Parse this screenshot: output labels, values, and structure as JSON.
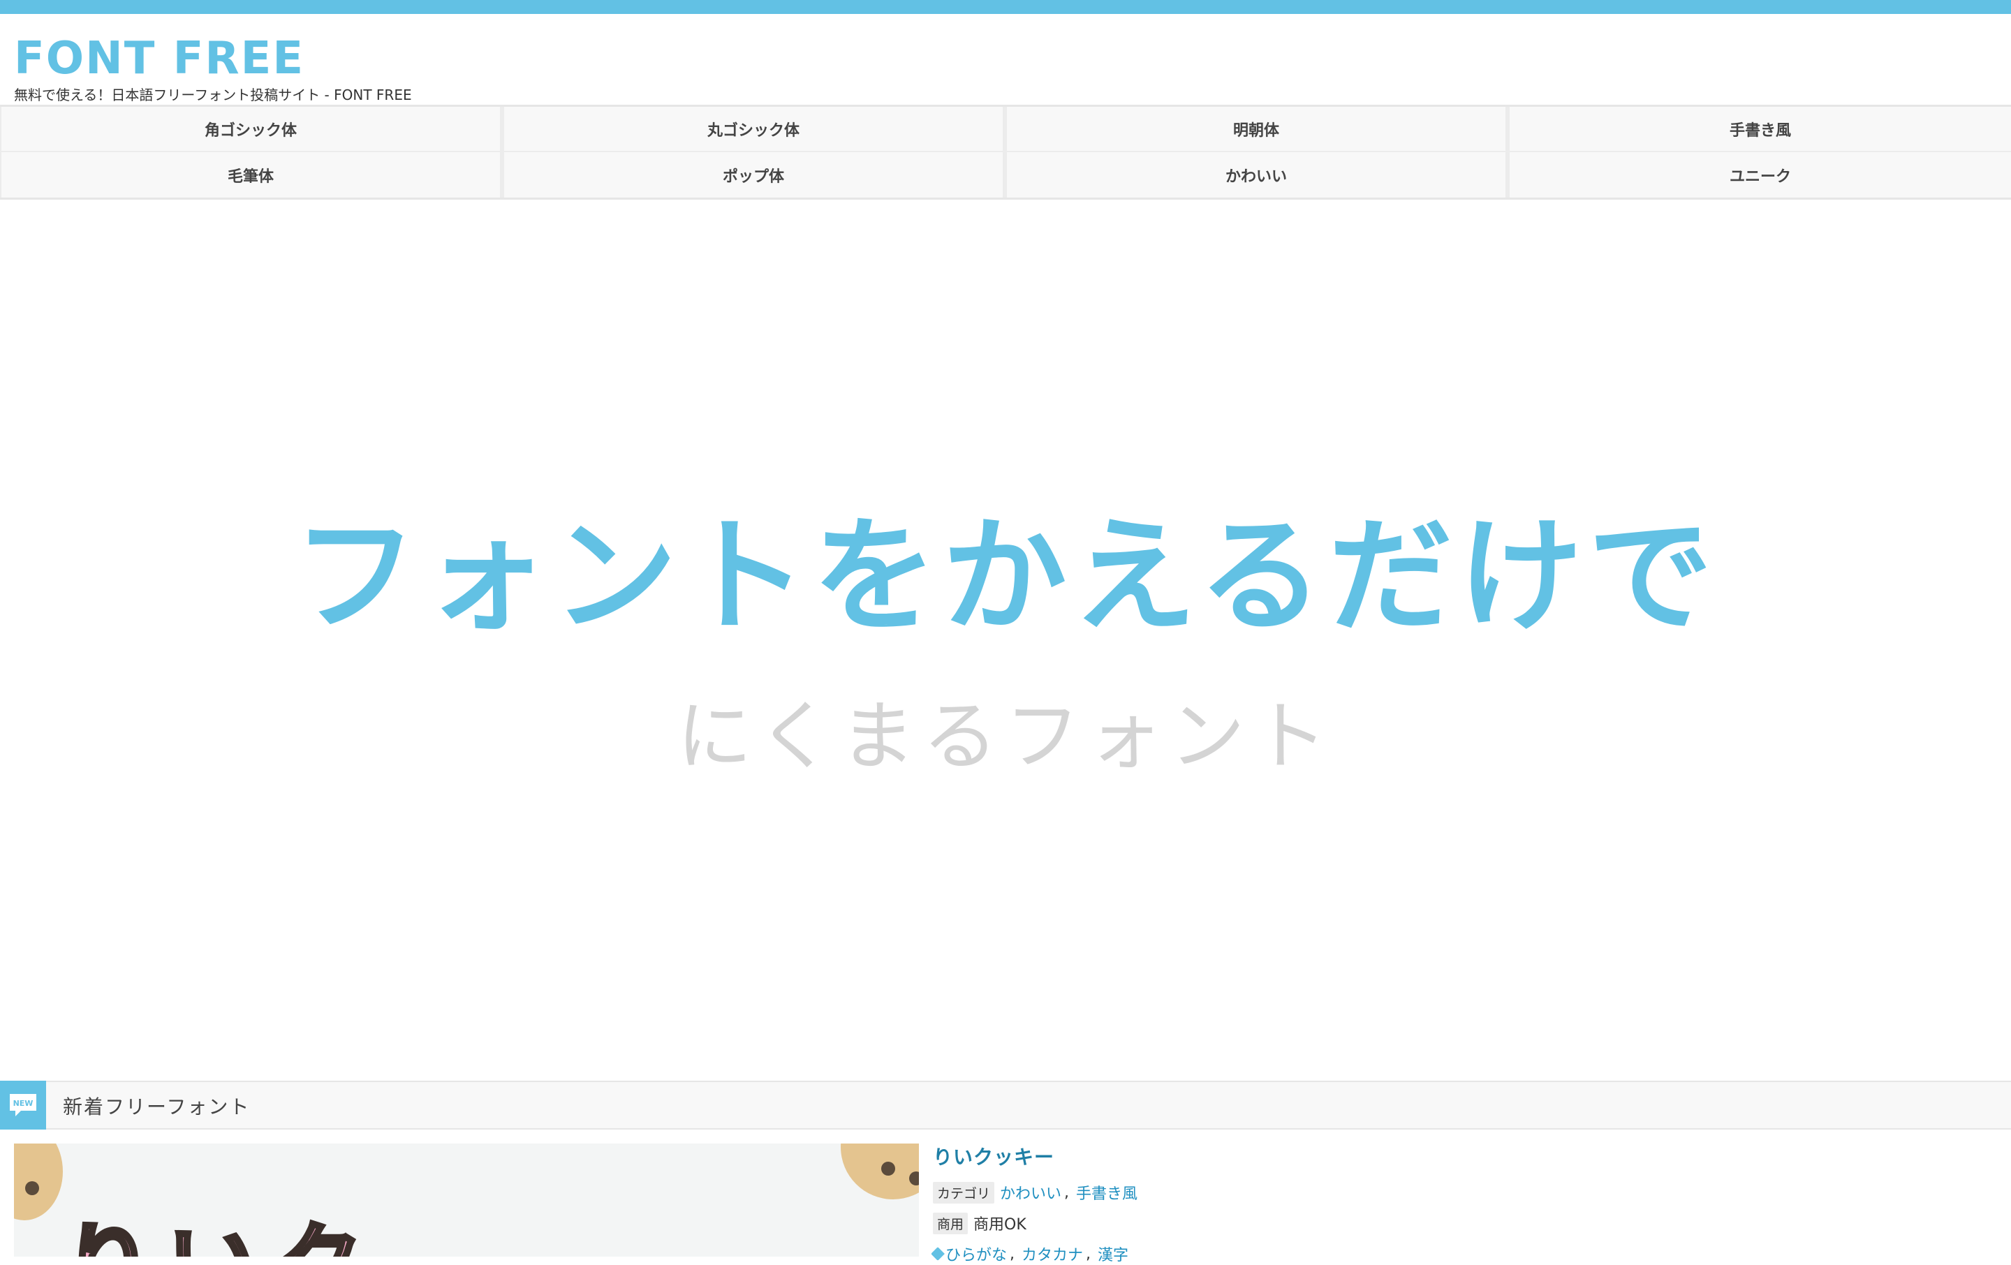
{
  "site": {
    "logo": "FONT FREE",
    "tagline": "無料で使える！日本語フリーフォント投稿サイト - FONT FREE",
    "accent_color": "#62c1e4"
  },
  "nav": {
    "items": [
      {
        "label": "角ゴシック体"
      },
      {
        "label": "丸ゴシック体"
      },
      {
        "label": "明朝体"
      },
      {
        "label": "手書き風"
      },
      {
        "label": "毛筆体"
      },
      {
        "label": "ポップ体"
      },
      {
        "label": "かわいい"
      },
      {
        "label": "ユニーク"
      }
    ]
  },
  "hero": {
    "headline": "フォントをかえるだけで",
    "subtext": "にくまるフォント"
  },
  "section": {
    "badge": "NEW",
    "badge_icon": "speech-bubble-icon",
    "title": "新着フリーフォント"
  },
  "latest_font": {
    "image_text": "りいク",
    "title": "りいクッキー",
    "category_label": "カテゴリ",
    "categories": [
      "かわいい",
      "手書き風"
    ],
    "commercial_label": "商用",
    "commercial_value": "商用OK",
    "tags": [
      "ひらがな",
      "カタカナ",
      "漢字"
    ],
    "tag_icon": "tag-icon"
  }
}
